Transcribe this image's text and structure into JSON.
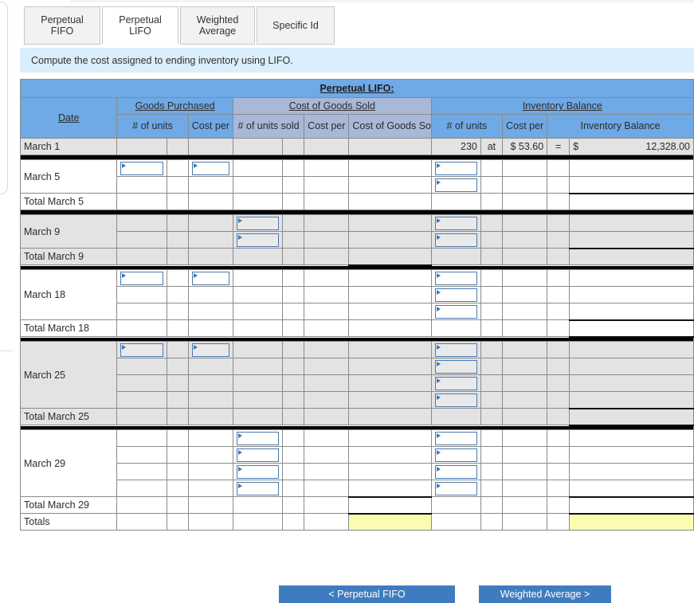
{
  "tabs": [
    {
      "id": "perpetual-fifo",
      "label": "Perpetual FIFO",
      "active": false
    },
    {
      "id": "perpetual-lifo",
      "label": "Perpetual LIFO",
      "active": true
    },
    {
      "id": "weighted-average",
      "label": "Weighted Average",
      "active": false
    },
    {
      "id": "specific-id",
      "label": "Specific Id",
      "active": false
    }
  ],
  "instruction": "Compute the cost assigned to ending inventory using LIFO.",
  "table": {
    "title": "Perpetual LIFO:",
    "date_header": "Date",
    "groups": {
      "goods_purchased": "Goods Purchased",
      "cost_of_goods_sold": "Cost of Goods Sold",
      "inventory_balance": "Inventory Balance"
    },
    "subheaders": {
      "gp_units": "# of units",
      "gp_cost": "Cost per unit",
      "cogs_units": "# of units sold",
      "cogs_cost": "Cost per unit",
      "cogs_total": "Cost of Goods Sold",
      "ib_units": "# of units",
      "ib_cost": "Cost per unit",
      "ib_total": "Inventory Balance"
    },
    "march1": {
      "date": "March 1",
      "units": "230",
      "at": "at",
      "cost": "$ 53.60",
      "eq": "=",
      "dollar": "$",
      "balance": "12,328.00"
    },
    "rows": {
      "march5": "March 5",
      "total_march5": "Total March 5",
      "march9": "March 9",
      "total_march9": "Total March 9",
      "march18": "March 18",
      "total_march18": "Total March 18",
      "march25": "March 25",
      "total_march25": "Total March 25",
      "march29": "March 29",
      "total_march29": "Total March 29",
      "totals": "Totals"
    }
  },
  "footer": {
    "prev_label": "< Perpetual FIFO",
    "next_label": "Weighted Average >"
  },
  "colors": {
    "header_blue": "#6fa9e6",
    "cogs_blue": "#a8b8d8",
    "instruction_blue": "#dbeefc",
    "answer_yellow": "#fcfcb0",
    "button_blue": "#3f7cbf",
    "input_border": "#4a7ab0"
  }
}
